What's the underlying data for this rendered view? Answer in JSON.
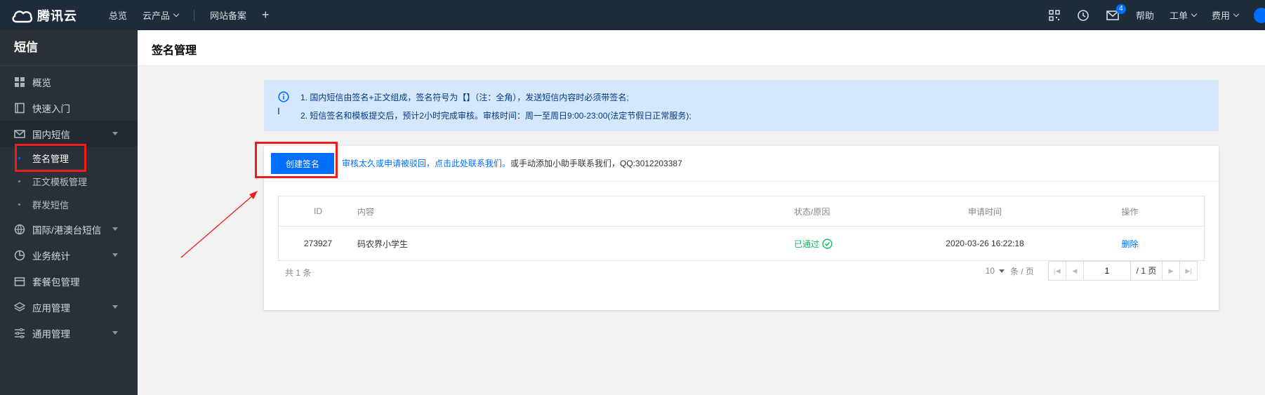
{
  "brand": {
    "name": "腾讯云"
  },
  "topnav": {
    "overview": "总览",
    "products": "云产品",
    "icp": "网站备案",
    "add": "+"
  },
  "topright": {
    "mail_badge": "4",
    "help": "帮助",
    "tickets": "工单",
    "billing": "费用"
  },
  "sidebar": {
    "title": "短信",
    "items": [
      {
        "label": "概览"
      },
      {
        "label": "快速入门"
      },
      {
        "label": "国内短信"
      },
      {
        "label": "签名管理"
      },
      {
        "label": "正文模板管理"
      },
      {
        "label": "群发短信"
      },
      {
        "label": "国际/港澳台短信"
      },
      {
        "label": "业务统计"
      },
      {
        "label": "套餐包管理"
      },
      {
        "label": "应用管理"
      },
      {
        "label": "通用管理"
      }
    ]
  },
  "page": {
    "title": "签名管理"
  },
  "notice": {
    "line1": "1. 国内短信由签名+正文组成，签名符号为【】（注：全角），发送短信内容时必须带签名;",
    "line2": "2. 短信签名和模板提交后，预计2小时完成审核。审核时间：周一至周日9:00-23:00(法定节假日正常服务);"
  },
  "toolbar": {
    "create_label": "创建签名",
    "tip_link": "审核太久或申请被驳回，点击此处联系我们。",
    "tip_text": "或手动添加小助手联系我们，QQ:3012203387"
  },
  "table": {
    "headers": {
      "id": "ID",
      "content": "内容",
      "status": "状态/原因",
      "time": "申请时间",
      "op": "操作"
    },
    "rows": [
      {
        "id": "273927",
        "content": "码农界小学生",
        "status": "已通过",
        "time": "2020-03-26 16:22:18",
        "op": "删除"
      }
    ]
  },
  "pagination": {
    "total": "共 1 条",
    "per_page": "10",
    "per_page_unit": "条 / 页",
    "current": "1",
    "total_pages": "/ 1 页"
  },
  "colors": {
    "accent": "#006eff",
    "success": "#0abf5b",
    "annotation": "#ee1d1d",
    "topbar": "#1e2b3a",
    "sidebar": "#293038"
  }
}
